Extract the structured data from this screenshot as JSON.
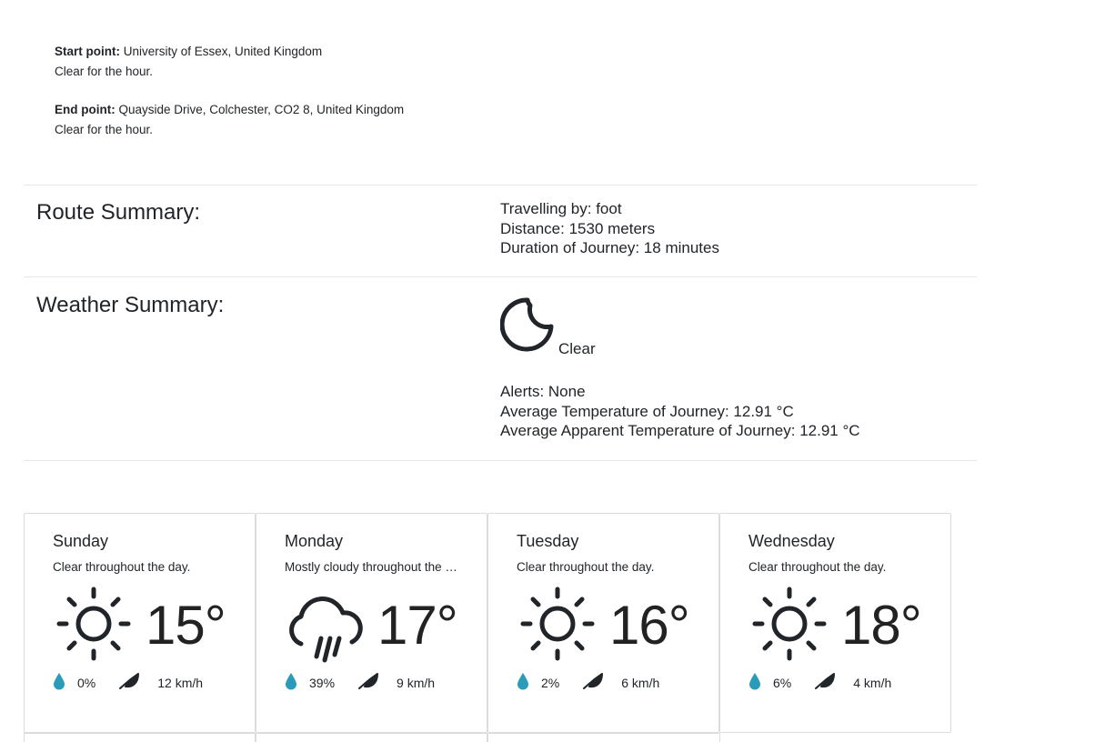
{
  "journey": {
    "start_label": "Start point:",
    "start_value": "University of Essex, United Kingdom",
    "start_status": "Clear for the hour.",
    "end_label": "End point:",
    "end_value": "Quayside Drive, Colchester, CO2 8, United Kingdom",
    "end_status": "Clear for the hour."
  },
  "route_summary": {
    "title": "Route Summary:",
    "travelling_by": "Travelling by: foot",
    "distance": "Distance: 1530 meters",
    "duration": "Duration of Journey: 18 minutes"
  },
  "weather_summary": {
    "title": "Weather Summary:",
    "icon": "clear-night-icon",
    "condition": "Clear",
    "alerts": "Alerts: None",
    "avg_temp": "Average Temperature of Journey: 12.91 °C",
    "avg_apparent_temp": "Average Apparent Temperature of Journey: 12.91 °C"
  },
  "forecast": [
    {
      "day": "Sunday",
      "summary": "Clear throughout the day.",
      "icon": "sun-icon",
      "temp": "15°",
      "precip": "0%",
      "wind": "12 km/h"
    },
    {
      "day": "Monday",
      "summary": "Mostly cloudy throughout the day.",
      "icon": "rain-icon",
      "temp": "17°",
      "precip": "39%",
      "wind": "9 km/h"
    },
    {
      "day": "Tuesday",
      "summary": "Clear throughout the day.",
      "icon": "sun-icon",
      "temp": "16°",
      "precip": "2%",
      "wind": "6 km/h"
    },
    {
      "day": "Wednesday",
      "summary": "Clear throughout the day.",
      "icon": "sun-icon",
      "temp": "18°",
      "precip": "6%",
      "wind": "4 km/h"
    }
  ],
  "colors": {
    "drop": "#2a9bb8",
    "text": "#212529",
    "border": "#dcdcdc"
  }
}
